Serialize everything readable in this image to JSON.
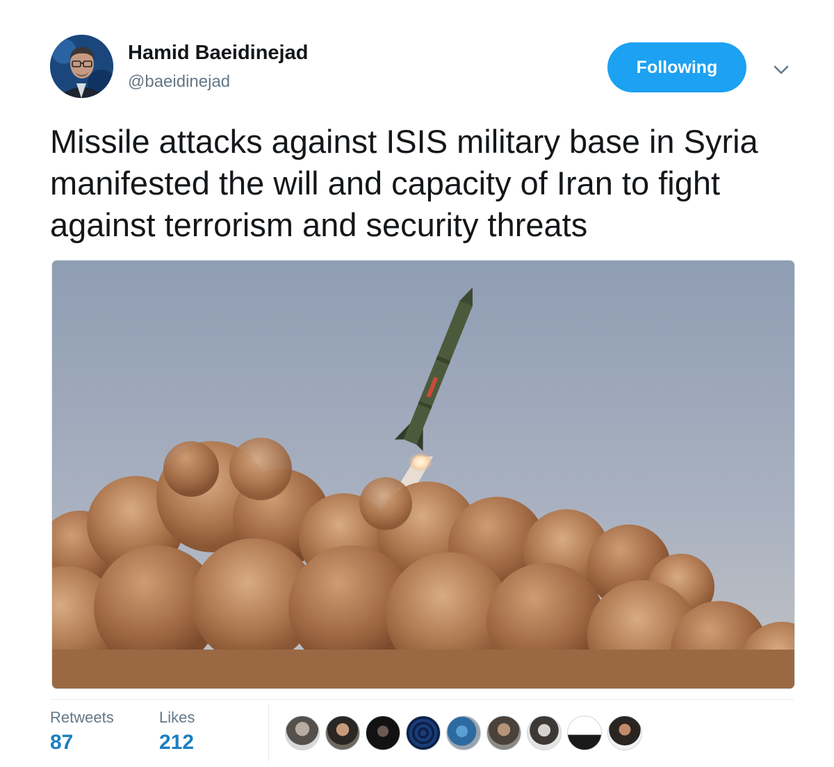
{
  "tweet": {
    "author": {
      "name": "Hamid Baeidinejad",
      "handle": "@baeidinejad"
    },
    "follow_button_label": "Following",
    "text": "Missile attacks against ISIS military base in Syria manifested the will and capacity of Iran to fight against terrorism and security threats",
    "stats": {
      "retweets_label": "Retweets",
      "retweets_count": "87",
      "likes_label": "Likes",
      "likes_count": "212"
    }
  },
  "colors": {
    "follow_button": "#1da1f2",
    "stat_value": "#1b7fbf",
    "secondary_text": "#657786"
  },
  "icons": {
    "menu": "chevron-down-icon"
  },
  "liker_avatar_count": 9
}
